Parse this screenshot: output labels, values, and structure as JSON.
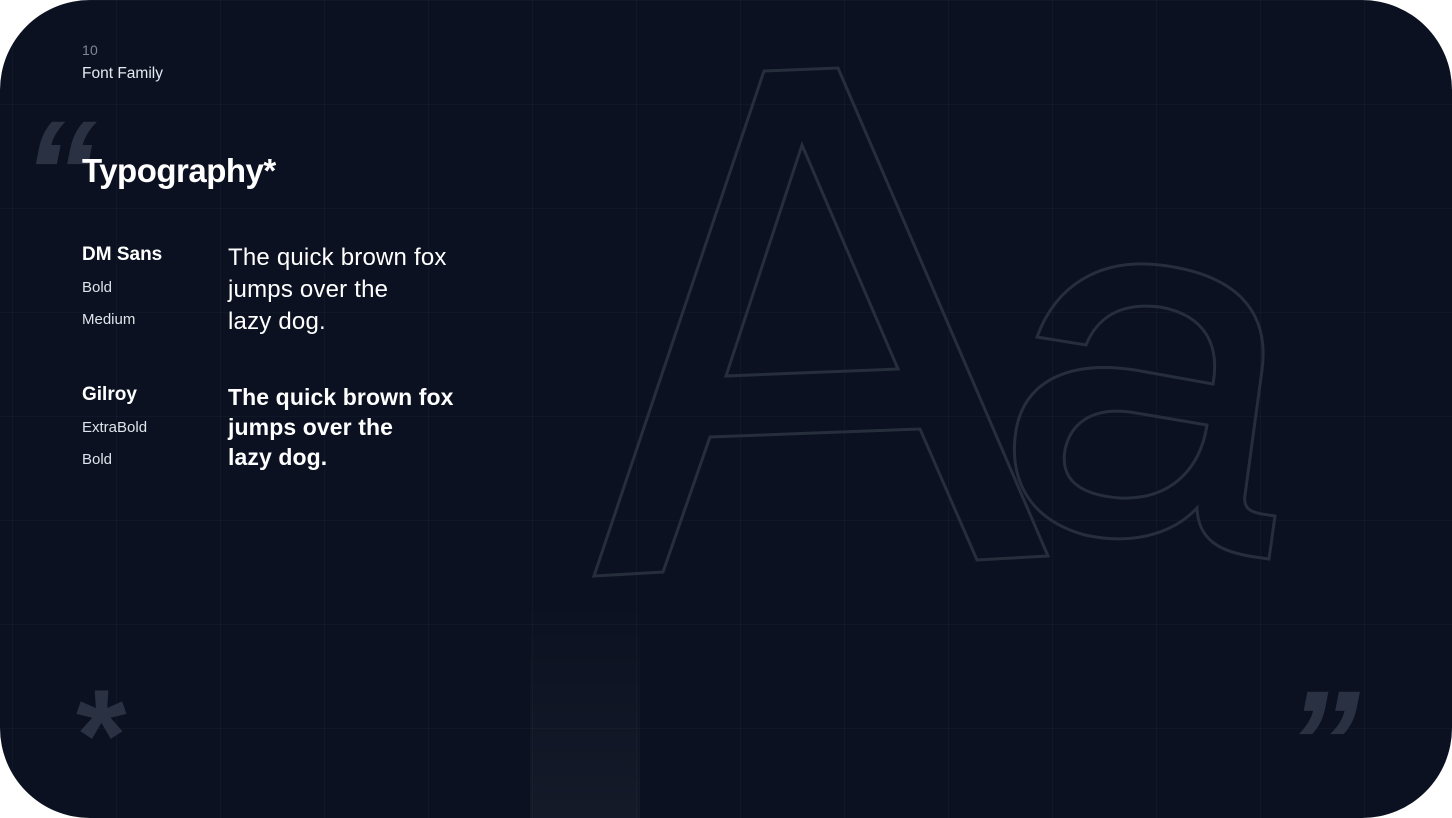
{
  "header": {
    "page_number": "10",
    "section": "Font Family"
  },
  "title": "Typography*",
  "fonts": [
    {
      "name": "DM Sans",
      "weights": [
        "Bold",
        "Medium"
      ],
      "sample_lines": [
        "The quick brown fox",
        "jumps over the",
        "lazy dog."
      ]
    },
    {
      "name": "Gilroy",
      "weights": [
        "ExtraBold",
        "Bold"
      ],
      "sample_lines": [
        "The quick brown fox",
        "jumps over the",
        "lazy dog."
      ]
    }
  ],
  "decor": {
    "quote_open": "“",
    "quote_close": "”",
    "asterisk": "*",
    "outline_letters": "Aa"
  },
  "colors": {
    "background": "#0b1120",
    "text": "#ffffff",
    "muted": "#7e8796",
    "outline": "#262d3b",
    "decor": "#2a3142"
  }
}
